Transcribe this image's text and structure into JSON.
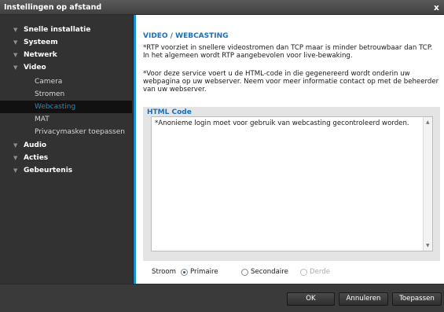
{
  "window": {
    "title": "Instellingen op afstand",
    "close_glyph": "x"
  },
  "sidebar": {
    "items": [
      {
        "label": "Snelle installatie"
      },
      {
        "label": "Systeem"
      },
      {
        "label": "Netwerk"
      },
      {
        "label": "Video",
        "children": [
          {
            "label": "Camera"
          },
          {
            "label": "Stromen"
          },
          {
            "label": "Webcasting"
          },
          {
            "label": "MAT"
          },
          {
            "label": "Privacymasker toepassen"
          }
        ]
      },
      {
        "label": "Audio"
      },
      {
        "label": "Acties"
      },
      {
        "label": "Gebeurtenis"
      }
    ],
    "active": "Webcasting"
  },
  "main": {
    "title": "VIDEO / WEBCASTING",
    "note1": "*RTP voorziet in snellere videostromen dan TCP maar is minder betrouwbaar dan TCP. In het algemeen wordt RTP aangebevolen voor live-bewaking.",
    "note2": "*Voor deze service voert u de HTML-code in die gegenereerd wordt onderin uw webpagina op uw webserver. Neem voor meer informatie contact op met de beheerder van uw webserver.",
    "html_code": {
      "label": "HTML Code",
      "text": "*Anonieme login moet voor gebruik van webcasting gecontroleerd worden."
    },
    "stream": {
      "label": "Stroom",
      "options": [
        {
          "label": "Primaire",
          "selected": true,
          "disabled": false
        },
        {
          "label": "Secondaire",
          "selected": false,
          "disabled": false
        },
        {
          "label": "Derde",
          "selected": false,
          "disabled": true
        }
      ]
    }
  },
  "footer": {
    "ok": "OK",
    "cancel": "Annuleren",
    "apply": "Toepassen"
  },
  "colors": {
    "accent": "#1a8fd0",
    "section_title": "#1e6fb5",
    "active_nav": "#1e8fc8"
  }
}
